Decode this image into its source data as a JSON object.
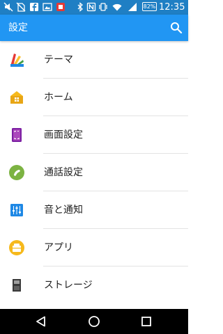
{
  "status_bar": {
    "battery": "82%",
    "time": "12:35",
    "icons": [
      "mute-icon",
      "no-sim-icon",
      "facebook-icon",
      "gallery-icon",
      "app-notification-icon",
      "bluetooth-icon",
      "nfc-icon",
      "vibrate-icon",
      "wifi-icon",
      "signal-icon",
      "battery-icon"
    ]
  },
  "app_bar": {
    "title": "設定",
    "search_icon": "search-icon"
  },
  "settings_items": [
    {
      "label": "テーマ",
      "icon": "theme-icon"
    },
    {
      "label": "ホーム",
      "icon": "home-icon"
    },
    {
      "label": "画面設定",
      "icon": "display-icon"
    },
    {
      "label": "通話設定",
      "icon": "call-icon"
    },
    {
      "label": "音と通知",
      "icon": "sound-icon"
    },
    {
      "label": "アプリ",
      "icon": "apps-icon"
    },
    {
      "label": "ストレージ",
      "icon": "storage-icon"
    }
  ],
  "nav_bar": {
    "buttons": [
      "back-icon",
      "home-icon",
      "recents-icon"
    ]
  },
  "colors": {
    "status_bar": "#1f7fc4",
    "app_bar": "#2196f3",
    "nav_bar": "#000000"
  }
}
